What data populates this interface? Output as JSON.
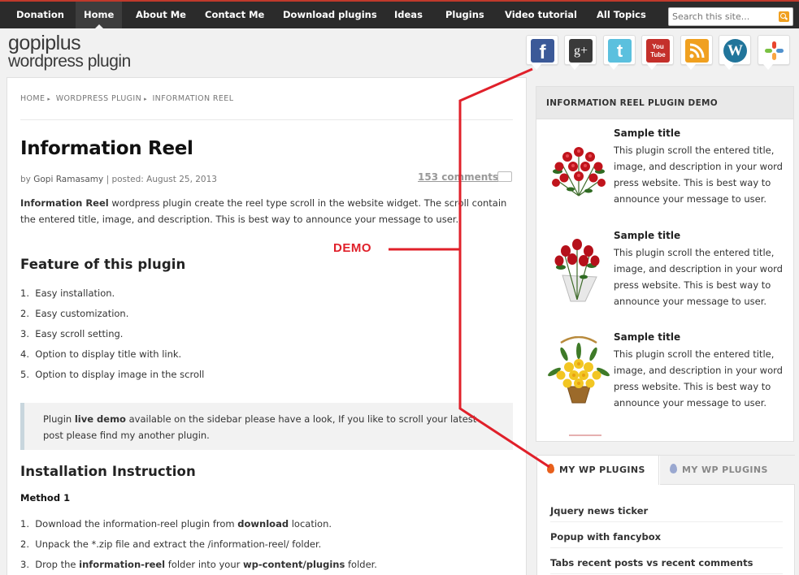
{
  "topnav": {
    "items": [
      "Donation",
      "Home",
      "About Me",
      "Contact Me",
      "Download plugins",
      "Ideas",
      "Plugins",
      "Video tutorial",
      "All Topics"
    ],
    "active": "Home"
  },
  "search": {
    "placeholder": "Search this site..."
  },
  "logo": {
    "line1": "gopiplus",
    "line2": "wordpress plugin"
  },
  "social": [
    {
      "name": "facebook-icon",
      "glyph": "f",
      "color": "#3b5998"
    },
    {
      "name": "google-plus-icon",
      "glyph": "g+",
      "color": "#3a3a3a"
    },
    {
      "name": "twitter-icon",
      "glyph": "t",
      "color": "#5bc0de"
    },
    {
      "name": "youtube-icon",
      "glyph": "You Tube",
      "color": "#c4302b"
    },
    {
      "name": "rss-icon",
      "glyph": "",
      "color": "#f0a020"
    },
    {
      "name": "wordpress-icon",
      "glyph": "W",
      "color": "#21759b"
    },
    {
      "name": "joomla-icon",
      "glyph": "",
      "color": "#ffffff"
    }
  ],
  "breadcrumb": [
    "HOME",
    "WORDPRESS PLUGIN",
    "INFORMATION REEL"
  ],
  "post": {
    "title": "Information Reel",
    "by": "by",
    "author": "Gopi Ramasamy",
    "posted": "| posted: August 25, 2013",
    "comments": "153 comments",
    "intro_bold": "Information Reel",
    "intro_rest": " wordpress plugin create the reel type scroll in the website widget. The scroll contain the entered title, image, and description. This is best way to announce your message to user.",
    "feature_heading": "Feature of this plugin",
    "features": [
      "Easy installation.",
      "Easy customization.",
      "Easy scroll setting.",
      "Option to display title with link.",
      "Option to display image in the scroll"
    ],
    "note_pre": "Plugin ",
    "note_bold": "live demo",
    "note_post": " available on the sidebar please have a look, If you like to scroll your latest post please find my another plugin.",
    "install_heading": "Installation Instruction",
    "method": "Method 1",
    "steps": [
      {
        "pre": "Download the information-reel plugin from ",
        "b1": "download",
        "mid": " location.",
        "b2": "",
        "post": ""
      },
      {
        "pre": "Unpack the *.zip file and extract the /information-reel/ folder.",
        "b1": "",
        "mid": "",
        "b2": "",
        "post": ""
      },
      {
        "pre": "Drop the ",
        "b1": "information-reel",
        "mid": " folder into your ",
        "b2": "wp-content/plugins",
        "post": " folder."
      }
    ]
  },
  "sidebar": {
    "heading": "INFORMATION REEL PLUGIN DEMO",
    "items": [
      {
        "title": "Sample title",
        "desc": "This plugin scroll the entered title, image, and description in your word press website. This is best way to announce your message to user."
      },
      {
        "title": "Sample title",
        "desc": "This plugin scroll the entered title, image, and description in your word press website. This is best way to announce your message to user."
      },
      {
        "title": "Sample title",
        "desc": "This plugin scroll the entered title, image, and description in your word press website. This is best way to announce your message to user."
      }
    ]
  },
  "tabs": {
    "active": "MY WP PLUGINS",
    "inactive": "MY WP PLUGINS",
    "links": [
      "Jquery news ticker",
      "Popup with fancybox",
      "Tabs recent posts vs recent comments"
    ]
  },
  "annotation": {
    "label": "DEMO",
    "color": "#e0202a"
  }
}
